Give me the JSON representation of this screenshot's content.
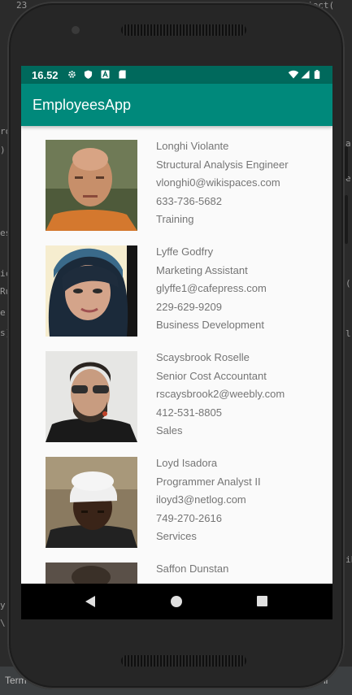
{
  "ide": {
    "fragments": [
      "23",
      "ject(",
      "ro",
      ")",
      "es",
      "ic",
      "Ru",
      "e",
      "s)",
      "a",
      "e",
      "(",
      "l",
      "y",
      "\\",
      "ih",
      "Term",
      "li"
    ]
  },
  "status_bar": {
    "time": "16.52",
    "icons": [
      "gear-icon",
      "shield-icon",
      "a-icon",
      "sdcard-icon",
      "wifi-icon",
      "signal-icon",
      "battery-icon"
    ]
  },
  "app_bar": {
    "title": "EmployeesApp"
  },
  "colors": {
    "primary": "#00897b",
    "primary_dark": "#00695c",
    "text_secondary": "#757575"
  },
  "employees": [
    {
      "name": "Longhi Violante",
      "title": "Structural Analysis Engineer",
      "email": "vlonghi0@wikispaces.com",
      "phone": "633-736-5682",
      "department": "Training"
    },
    {
      "name": "Lyffe Godfry",
      "title": "Marketing Assistant",
      "email": "glyffe1@cafepress.com",
      "phone": "229-629-9209",
      "department": "Business Development"
    },
    {
      "name": "Scaysbrook Roselle",
      "title": "Senior Cost Accountant",
      "email": "rscaysbrook2@weebly.com",
      "phone": "412-531-8805",
      "department": "Sales"
    },
    {
      "name": "Loyd Isadora",
      "title": "Programmer Analyst II",
      "email": "iloyd3@netlog.com",
      "phone": "749-270-2616",
      "department": "Services"
    },
    {
      "name": "Saffon Dunstan"
    }
  ],
  "nav_bar": {
    "icons": [
      "back-icon",
      "home-icon",
      "recents-icon"
    ]
  }
}
